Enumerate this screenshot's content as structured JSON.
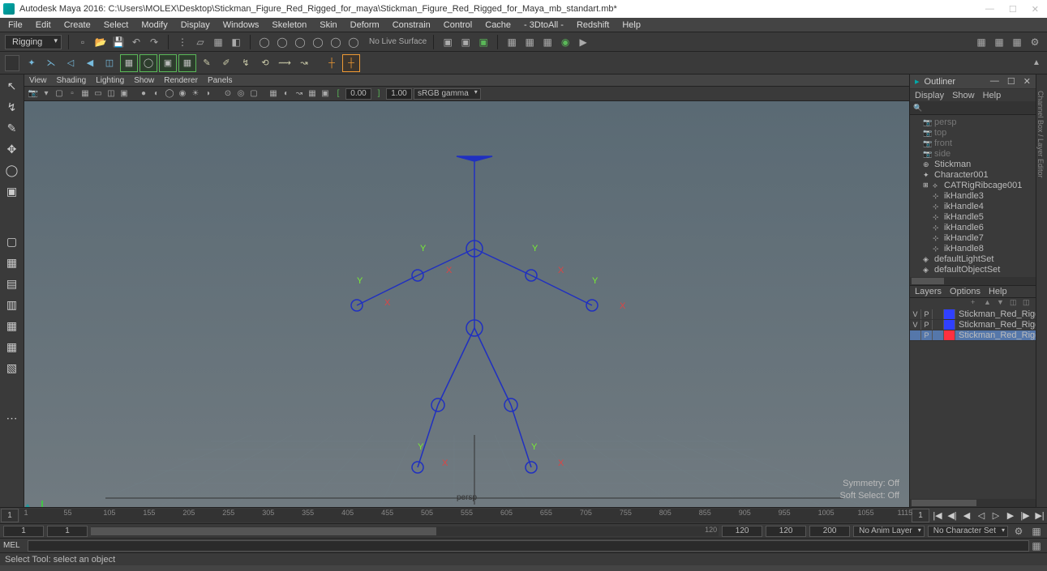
{
  "title": "Autodesk Maya 2016: C:\\Users\\MOLEX\\Desktop\\Stickman_Figure_Red_Rigged_for_maya\\Stickman_Figure_Red_Rigged_for_Maya_mb_standart.mb*",
  "menus": [
    "File",
    "Edit",
    "Create",
    "Select",
    "Modify",
    "Display",
    "Windows",
    "Skeleton",
    "Skin",
    "Deform",
    "Constrain",
    "Control",
    "Cache",
    "- 3DtoAll -",
    "Redshift",
    "Help"
  ],
  "workspace": "Rigging",
  "noLive": "No Live Surface",
  "vpMenus": [
    "View",
    "Shading",
    "Lighting",
    "Show",
    "Renderer",
    "Panels"
  ],
  "gamma_val1": "0.00",
  "gamma_val2": "1.00",
  "gamma_dd": "sRGB gamma",
  "vp_name": "persp",
  "vp_status": {
    "sym": "Symmetry:",
    "sym_v": "Off",
    "ss": "Soft Select:",
    "ss_v": "Off"
  },
  "outliner": {
    "title": "Outliner",
    "menus": [
      "Display",
      "Show",
      "Help"
    ],
    "items": [
      {
        "icon": "cam",
        "label": "persp",
        "dim": true
      },
      {
        "icon": "cam",
        "label": "top",
        "dim": true
      },
      {
        "icon": "cam",
        "label": "front",
        "dim": true
      },
      {
        "icon": "cam",
        "label": "side",
        "dim": true
      },
      {
        "icon": "grp",
        "label": "Stickman"
      },
      {
        "icon": "char",
        "label": "Character001"
      },
      {
        "icon": "bone",
        "label": "CATRigRibcage001",
        "exp": "+",
        "l2": true
      },
      {
        "icon": "ik",
        "label": "ikHandle3",
        "l2": true
      },
      {
        "icon": "ik",
        "label": "ikHandle4",
        "l2": true
      },
      {
        "icon": "ik",
        "label": "ikHandle5",
        "l2": true
      },
      {
        "icon": "ik",
        "label": "ikHandle6",
        "l2": true
      },
      {
        "icon": "ik",
        "label": "ikHandle7",
        "l2": true
      },
      {
        "icon": "ik",
        "label": "ikHandle8",
        "l2": true
      },
      {
        "icon": "set",
        "label": "defaultLightSet"
      },
      {
        "icon": "set",
        "label": "defaultObjectSet"
      }
    ]
  },
  "layers": {
    "menus": [
      "Layers",
      "Options",
      "Help"
    ],
    "rows": [
      {
        "v": "V",
        "p": "P",
        "color": "#3040ff",
        "name": "Stickman_Red_Rigged"
      },
      {
        "v": "V",
        "p": "P",
        "color": "#3040ff",
        "name": "Stickman_Red_Rigged"
      },
      {
        "v": "",
        "p": "P",
        "color": "#ff3040",
        "name": "Stickman_Red_Rigged",
        "sel": true
      }
    ]
  },
  "timeline": {
    "cur": "1",
    "ticks": [
      "1",
      "55",
      "105",
      "155",
      "205",
      "255",
      "305",
      "355",
      "405",
      "455",
      "505",
      "555",
      "605",
      "655",
      "705",
      "755",
      "805",
      "855",
      "905",
      "955",
      "1005",
      "1055",
      "1115"
    ],
    "end": "1"
  },
  "range": {
    "start": "1",
    "rstart": "1",
    "rend": "120",
    "end": "120",
    "fps": "200",
    "animlayer": "No Anim Layer",
    "charset": "No Character Set"
  },
  "cmd": "MEL",
  "help": "Select Tool: select an object",
  "rside_label": "Channel Box / Layer Editor"
}
